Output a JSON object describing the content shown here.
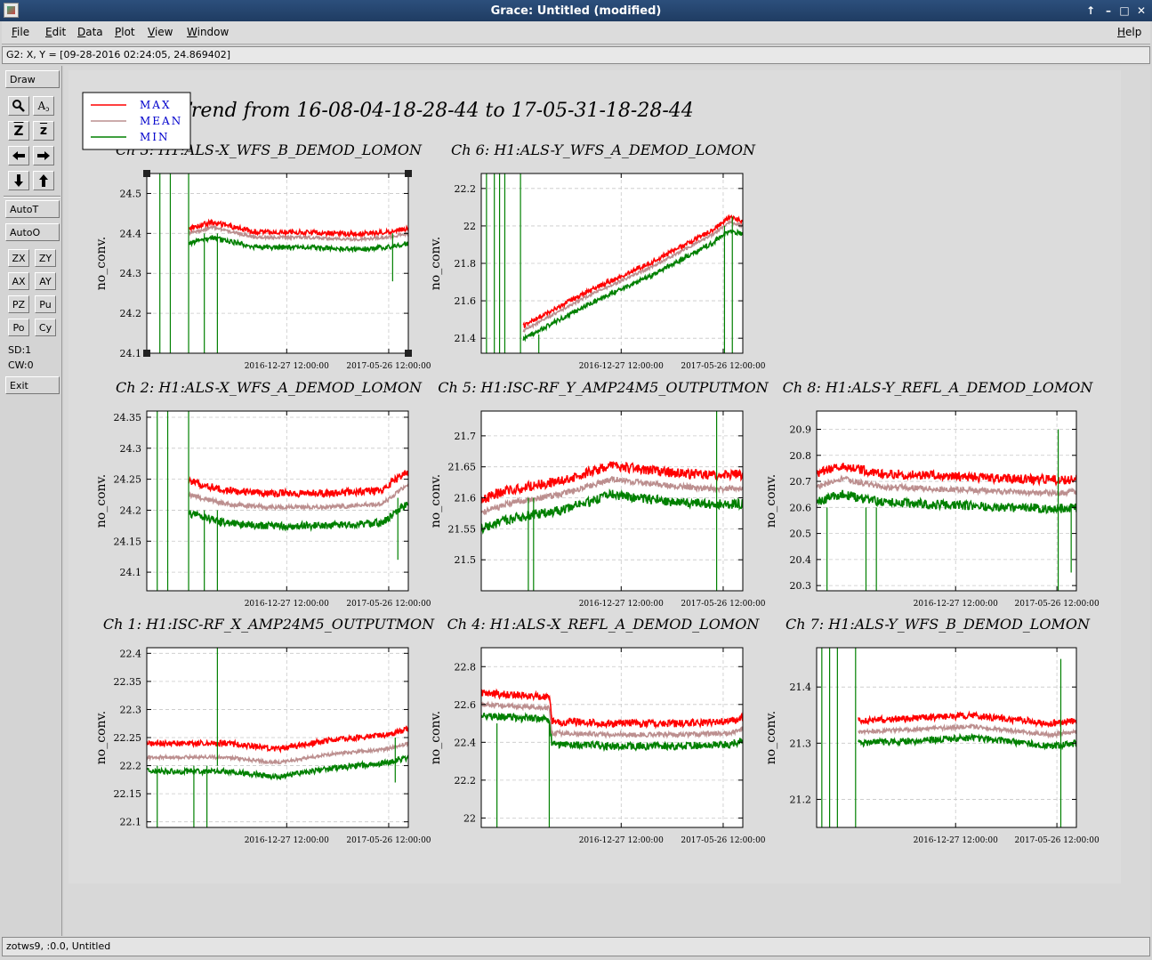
{
  "window": {
    "title": "Grace: Untitled (modified)",
    "controls": [
      "↑",
      "–",
      "□",
      "✕"
    ]
  },
  "menubar": {
    "items": [
      "File",
      "Edit",
      "Data",
      "Plot",
      "View",
      "Window"
    ],
    "help": "Help"
  },
  "locator": {
    "text": "G2: X, Y = [09-28-2016 02:24:05, 24.869402]"
  },
  "toolbar": {
    "draw": "Draw",
    "icon_buttons": [
      "zoom-icon",
      "autoscale-icon",
      "zoom-in-icon",
      "zoom-out-icon",
      "arrow-left-icon",
      "arrow-right-icon",
      "arrow-down-icon",
      "arrow-up-icon"
    ],
    "zoom_in_glyph": "Z",
    "zoom_out_glyph": "z",
    "autoscale_glyph": "A",
    "autot": "AutoT",
    "autoo": "AutoO",
    "small_buttons": [
      "ZX",
      "ZY",
      "AX",
      "AY",
      "PZ",
      "Pu",
      "Po",
      "Cy"
    ],
    "sd": "SD:1",
    "cw": "CW:0",
    "exit": "Exit"
  },
  "status": {
    "text": "zotws9, :0.0, Untitled"
  },
  "legend": {
    "entries": [
      {
        "label": "MAX",
        "color": "#ff0000"
      },
      {
        "label": "MEAN",
        "color": "#bc8f8f"
      },
      {
        "label": "MIN",
        "color": "#008000"
      }
    ],
    "text_color": "#0000cc"
  },
  "colors": {
    "max": "#ff0000",
    "mean": "#bc8f8f",
    "min": "#008000"
  },
  "chart_data": {
    "type": "line",
    "title": "Trend from 16-08-04-18-28-44 to 17-05-31-18-28-44",
    "x_tick_labels": [
      "2016-12-27 12:00:00",
      "2017-05-26 12:00:00"
    ],
    "x_range": [
      "2016-08-04 18:28:44",
      "2017-05-31 18:28:44"
    ],
    "ylabel": "no_conv.",
    "grid": true,
    "legend_position": "top-left",
    "series_names": [
      "MAX",
      "MEAN",
      "MIN"
    ],
    "panels": [
      {
        "id": "ch3",
        "title": "Ch 3: H1:ALS-X_WFS_B_DEMOD_LOMON",
        "ylim": [
          24.1,
          24.55
        ],
        "yticks": [
          24.1,
          24.2,
          24.3,
          24.4,
          24.5
        ],
        "y_tick_labels": [
          "24.1",
          "24.2",
          "24.3",
          "24.4",
          "24.5"
        ],
        "selected": true,
        "knots": [
          [
            0.16,
            24.4
          ],
          [
            0.25,
            24.415
          ],
          [
            0.42,
            24.39
          ],
          [
            0.6,
            24.39
          ],
          [
            0.8,
            24.385
          ],
          [
            0.92,
            24.39
          ],
          [
            1.0,
            24.4
          ]
        ],
        "max_off": 0.013,
        "min_off": -0.025,
        "noise": 0.006,
        "start": 0.16,
        "gap_start": 0.06,
        "gap_end": 0.16,
        "spikes": [
          [
            0.05,
            24.1,
            24.55
          ],
          [
            0.09,
            24.1,
            24.55
          ],
          [
            0.16,
            24.1,
            24.55
          ],
          [
            0.22,
            24.1,
            24.4
          ],
          [
            0.27,
            24.1,
            24.4
          ],
          [
            0.94,
            24.28,
            24.4
          ]
        ]
      },
      {
        "id": "ch6",
        "title": "Ch 6: H1:ALS-Y_WFS_A_DEMOD_LOMON",
        "ylim": [
          21.32,
          22.28
        ],
        "yticks": [
          21.4,
          21.6,
          21.8,
          22.0,
          22.2
        ],
        "y_tick_labels": [
          "21.4",
          "21.6",
          "21.8",
          "22",
          "22.2"
        ],
        "selected": false,
        "knots": [
          [
            0.16,
            21.44
          ],
          [
            0.4,
            21.62
          ],
          [
            0.65,
            21.78
          ],
          [
            0.88,
            21.95
          ],
          [
            0.95,
            22.02
          ],
          [
            1.0,
            22.0
          ]
        ],
        "max_off": 0.025,
        "min_off": -0.045,
        "noise": 0.012,
        "start": 0.16,
        "gap_start": 0.0,
        "gap_end": 0.16,
        "spikes": [
          [
            0.02,
            21.32,
            22.28
          ],
          [
            0.05,
            21.32,
            22.28
          ],
          [
            0.07,
            21.32,
            22.28
          ],
          [
            0.09,
            21.32,
            22.28
          ],
          [
            0.15,
            21.32,
            22.28
          ],
          [
            0.22,
            21.32,
            21.42
          ],
          [
            0.93,
            21.32,
            22.0
          ],
          [
            0.96,
            21.32,
            22.05
          ]
        ]
      },
      {
        "id": "ch2",
        "title": "Ch 2: H1:ALS-X_WFS_A_DEMOD_LOMON",
        "ylim": [
          24.07,
          24.36
        ],
        "yticks": [
          24.1,
          24.15,
          24.2,
          24.25,
          24.3,
          24.35
        ],
        "y_tick_labels": [
          "24.1",
          "24.15",
          "24.2",
          "24.25",
          "24.3",
          "24.35"
        ],
        "selected": false,
        "knots": [
          [
            0.16,
            24.225
          ],
          [
            0.3,
            24.21
          ],
          [
            0.45,
            24.205
          ],
          [
            0.7,
            24.205
          ],
          [
            0.9,
            24.21
          ],
          [
            0.96,
            24.23
          ],
          [
            1.0,
            24.24
          ]
        ],
        "max_off": 0.022,
        "min_off": -0.03,
        "noise": 0.006,
        "start": 0.16,
        "gap_start": 0.0,
        "gap_end": 0.16,
        "spikes": [
          [
            0.04,
            24.07,
            24.36
          ],
          [
            0.08,
            24.07,
            24.36
          ],
          [
            0.16,
            24.07,
            24.36
          ],
          [
            0.22,
            24.07,
            24.2
          ],
          [
            0.27,
            24.07,
            24.2
          ],
          [
            0.96,
            24.12,
            24.22
          ]
        ]
      },
      {
        "id": "ch5",
        "title": "Ch 5: H1:ISC-RF_Y_AMP24M5_OUTPUTMON",
        "ylim": [
          21.45,
          21.74
        ],
        "yticks": [
          21.5,
          21.55,
          21.6,
          21.65,
          21.7
        ],
        "y_tick_labels": [
          "21.5",
          "21.55",
          "21.6",
          "21.65",
          "21.7"
        ],
        "selected": false,
        "knots": [
          [
            0.0,
            21.575
          ],
          [
            0.1,
            21.59
          ],
          [
            0.3,
            21.605
          ],
          [
            0.5,
            21.63
          ],
          [
            0.7,
            21.62
          ],
          [
            0.85,
            21.615
          ],
          [
            0.93,
            21.615
          ],
          [
            1.0,
            21.615
          ]
        ],
        "max_off": 0.022,
        "min_off": -0.025,
        "noise": 0.008,
        "start": 0.0,
        "gap_start": 0.0,
        "gap_end": 0.0,
        "spikes": [
          [
            0.18,
            21.45,
            21.6
          ],
          [
            0.2,
            21.45,
            21.6
          ],
          [
            0.9,
            21.45,
            21.74
          ]
        ]
      },
      {
        "id": "ch8",
        "title": "Ch 8: H1:ALS-Y_REFL_A_DEMOD_LOMON",
        "ylim": [
          20.28,
          20.97
        ],
        "yticks": [
          20.3,
          20.4,
          20.5,
          20.6,
          20.7,
          20.8,
          20.9
        ],
        "y_tick_labels": [
          "20.3",
          "20.4",
          "20.5",
          "20.6",
          "20.7",
          "20.8",
          "20.9"
        ],
        "selected": false,
        "knots": [
          [
            0.0,
            20.68
          ],
          [
            0.1,
            20.71
          ],
          [
            0.25,
            20.68
          ],
          [
            0.5,
            20.67
          ],
          [
            0.75,
            20.66
          ],
          [
            0.93,
            20.655
          ],
          [
            1.0,
            20.66
          ]
        ],
        "max_off": 0.05,
        "min_off": -0.06,
        "noise": 0.018,
        "start": 0.0,
        "gap_start": 0.0,
        "gap_end": 0.0,
        "spikes": [
          [
            0.04,
            20.28,
            20.6
          ],
          [
            0.19,
            20.28,
            20.6
          ],
          [
            0.23,
            20.28,
            20.6
          ],
          [
            0.93,
            20.28,
            20.9
          ],
          [
            0.98,
            20.35,
            20.6
          ]
        ]
      },
      {
        "id": "ch1",
        "title": "Ch 1: H1:ISC-RF_X_AMP24M5_OUTPUTMON",
        "ylim": [
          22.09,
          22.41
        ],
        "yticks": [
          22.1,
          22.15,
          22.2,
          22.25,
          22.3,
          22.35,
          22.4
        ],
        "y_tick_labels": [
          "22.1",
          "22.15",
          "22.2",
          "22.25",
          "22.3",
          "22.35",
          "22.4"
        ],
        "selected": false,
        "knots": [
          [
            0.0,
            22.215
          ],
          [
            0.3,
            22.215
          ],
          [
            0.5,
            22.205
          ],
          [
            0.7,
            22.22
          ],
          [
            0.92,
            22.23
          ],
          [
            1.0,
            22.24
          ]
        ],
        "max_off": 0.025,
        "min_off": -0.025,
        "noise": 0.005,
        "start": 0.0,
        "gap_start": 0.0,
        "gap_end": 0.0,
        "spikes": [
          [
            0.04,
            22.09,
            22.2
          ],
          [
            0.18,
            22.09,
            22.2
          ],
          [
            0.23,
            22.09,
            22.2
          ],
          [
            0.27,
            22.2,
            22.41
          ],
          [
            0.95,
            22.17,
            22.25
          ]
        ]
      },
      {
        "id": "ch4",
        "title": "Ch 4: H1:ALS-X_REFL_A_DEMOD_LOMON",
        "ylim": [
          21.95,
          22.9
        ],
        "yticks": [
          22.0,
          22.2,
          22.4,
          22.6,
          22.8
        ],
        "y_tick_labels": [
          "22",
          "22.2",
          "22.4",
          "22.6",
          "22.8"
        ],
        "selected": false,
        "knots": [
          [
            0.0,
            22.6
          ],
          [
            0.26,
            22.58
          ],
          [
            0.27,
            22.45
          ],
          [
            0.5,
            22.44
          ],
          [
            0.75,
            22.44
          ],
          [
            0.95,
            22.45
          ],
          [
            1.0,
            22.47
          ]
        ],
        "max_off": 0.06,
        "min_off": -0.06,
        "noise": 0.02,
        "start": 0.0,
        "gap_start": 0.0,
        "gap_end": 0.0,
        "spikes": [
          [
            0.06,
            21.95,
            22.5
          ],
          [
            0.26,
            21.95,
            22.5
          ]
        ]
      },
      {
        "id": "ch7",
        "title": "Ch 7: H1:ALS-Y_WFS_B_DEMOD_LOMON",
        "ylim": [
          21.15,
          21.47
        ],
        "yticks": [
          21.2,
          21.3,
          21.4
        ],
        "y_tick_labels": [
          "21.2",
          "21.3",
          "21.4"
        ],
        "selected": false,
        "knots": [
          [
            0.16,
            21.32
          ],
          [
            0.4,
            21.325
          ],
          [
            0.6,
            21.33
          ],
          [
            0.8,
            21.32
          ],
          [
            0.9,
            21.315
          ],
          [
            1.0,
            21.32
          ]
        ],
        "max_off": 0.02,
        "min_off": -0.02,
        "noise": 0.006,
        "start": 0.16,
        "gap_start": 0.0,
        "gap_end": 0.16,
        "spikes": [
          [
            0.02,
            21.15,
            21.47
          ],
          [
            0.05,
            21.15,
            21.47
          ],
          [
            0.08,
            21.15,
            21.47
          ],
          [
            0.15,
            21.15,
            21.47
          ],
          [
            0.94,
            21.15,
            21.45
          ]
        ]
      }
    ]
  }
}
